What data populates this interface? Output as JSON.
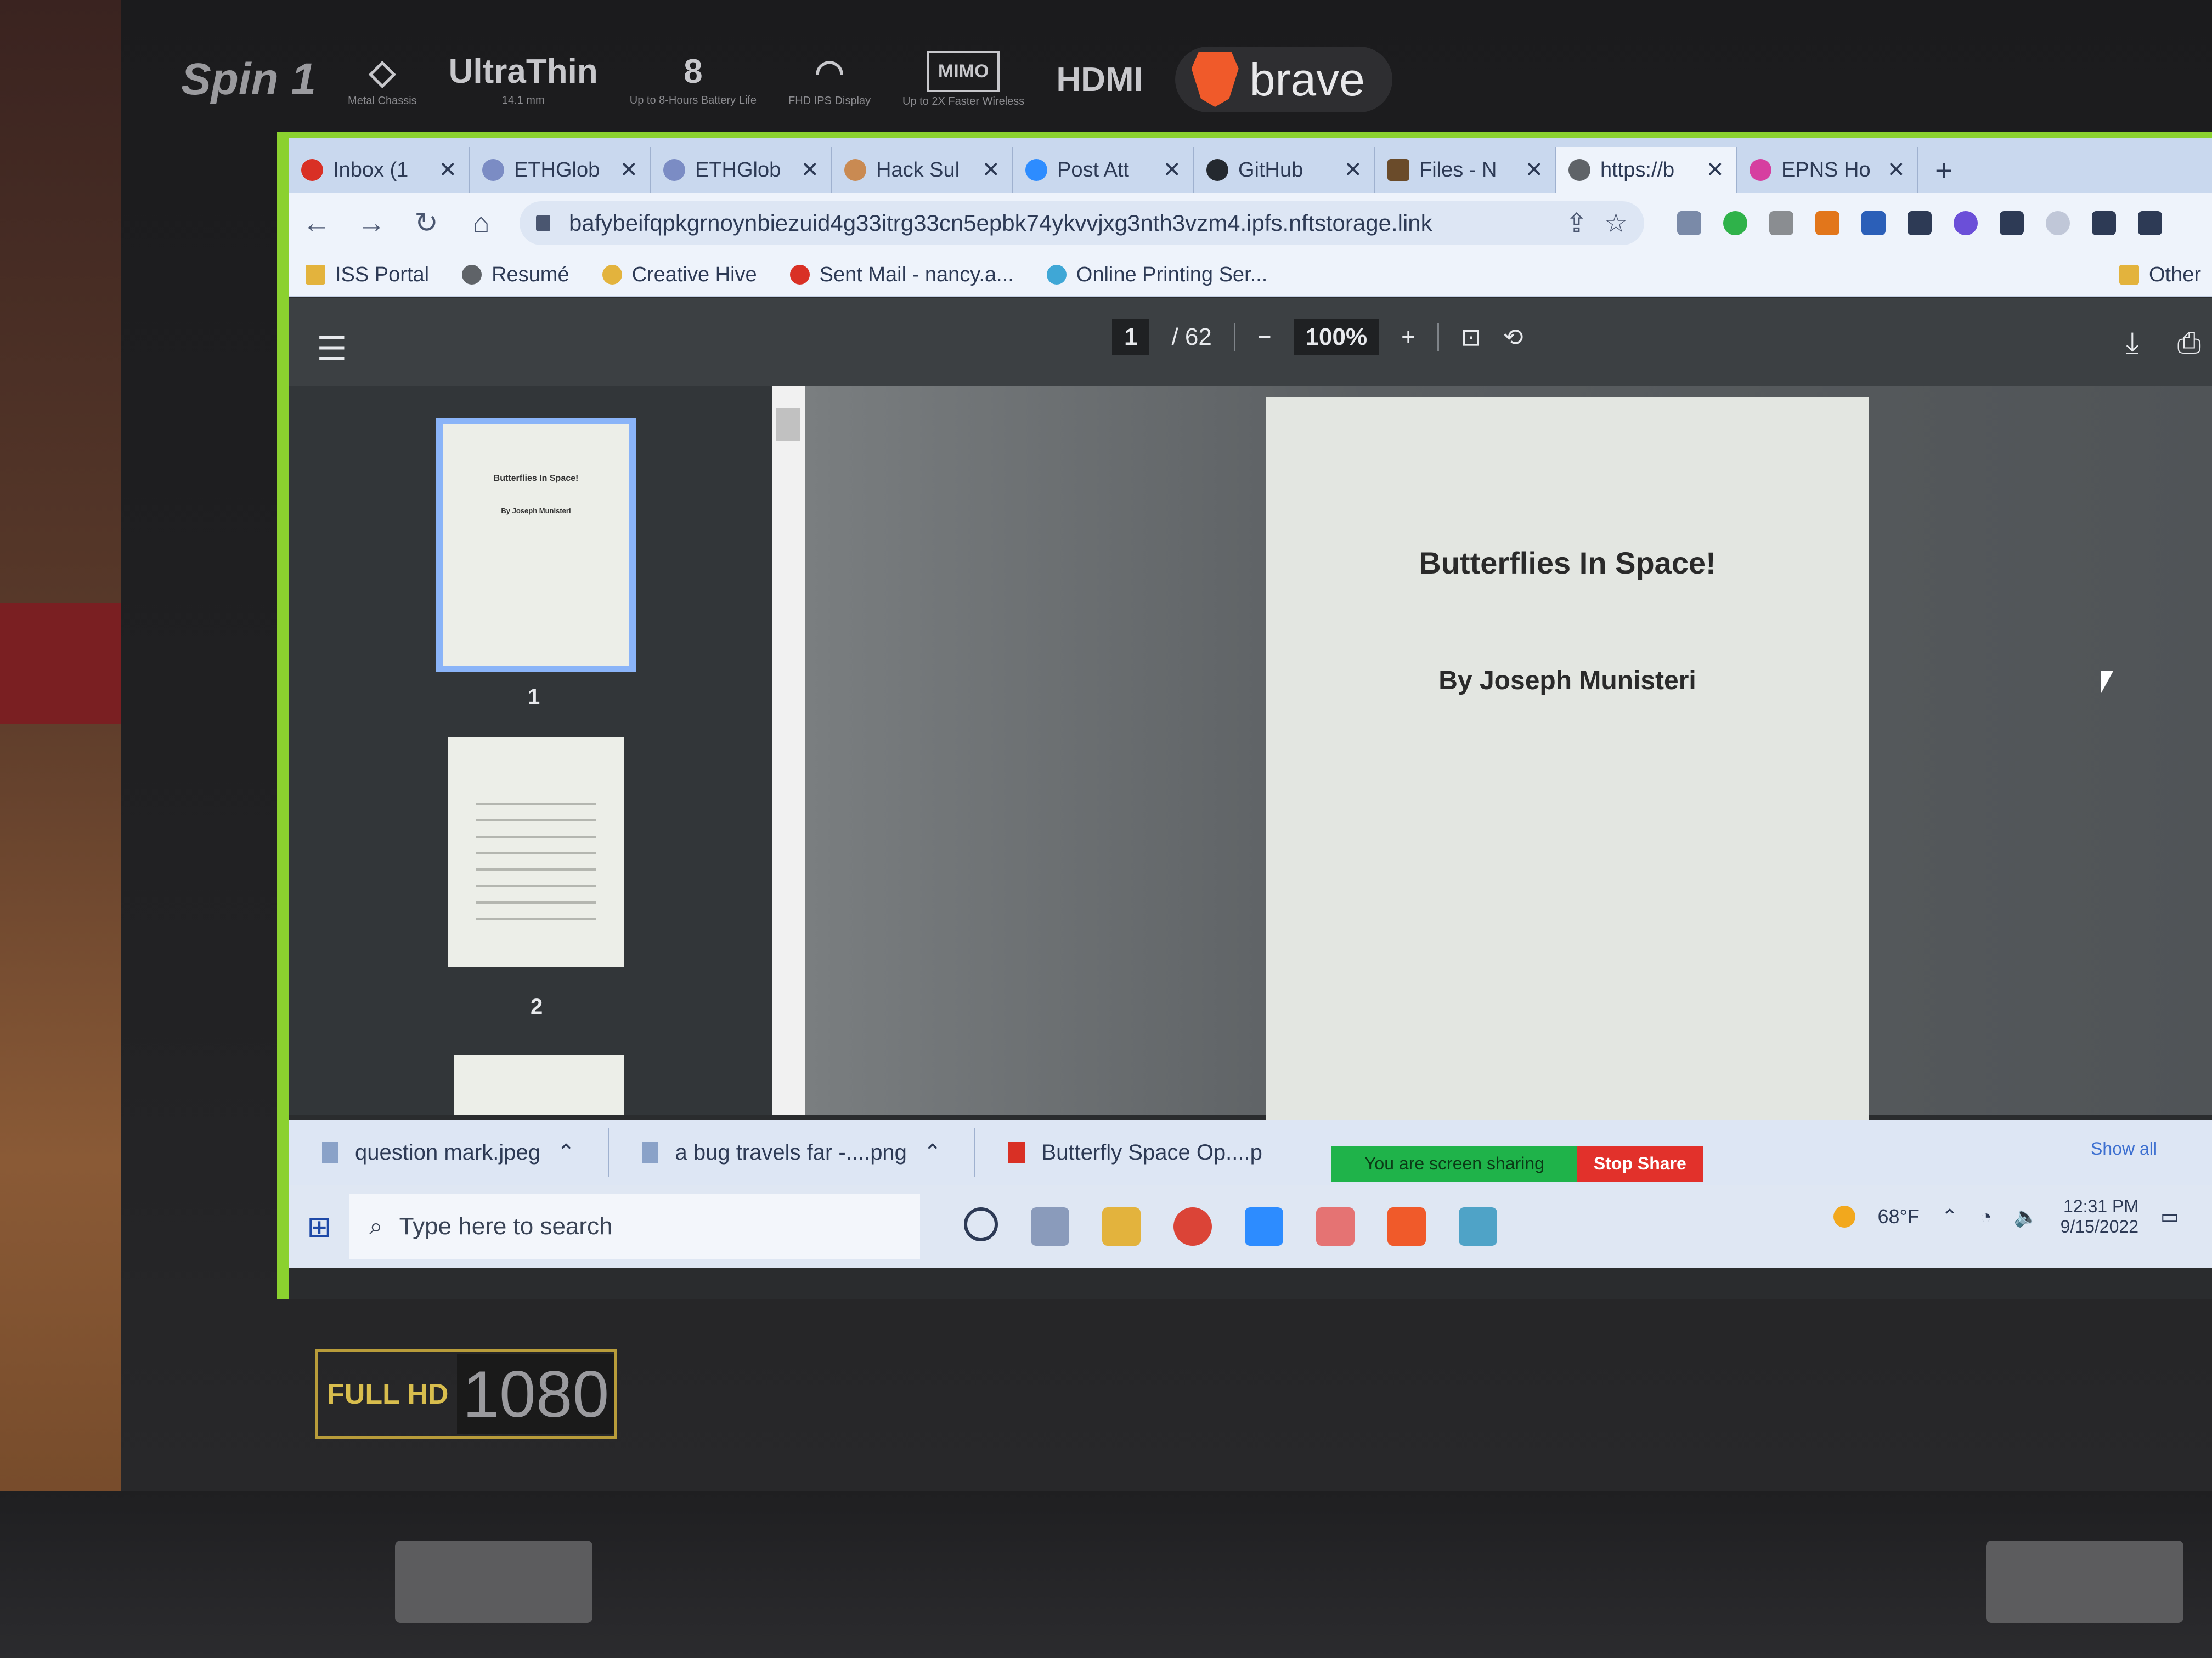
{
  "laptop": {
    "model": "Spin 1",
    "stickers": [
      {
        "big": "",
        "small": "Metal Chassis"
      },
      {
        "big": "UltraThin",
        "small": "14.1 mm"
      },
      {
        "big": "8",
        "small": "Up to 8-Hours Battery Life"
      },
      {
        "big": "",
        "small": "FHD IPS Display"
      },
      {
        "big": "MIMO",
        "small": "Up to 2X Faster Wireless"
      },
      {
        "big": "HDMI",
        "small": ""
      }
    ],
    "brave_badge": "brave",
    "fullhd_label": "FULL HD",
    "fullhd_number": "1080"
  },
  "browser": {
    "tabs": [
      {
        "label": "Inbox (1",
        "color": "#d93025"
      },
      {
        "label": "ETHGlob",
        "color": "#7b8cc4"
      },
      {
        "label": "ETHGlob",
        "color": "#7b8cc4"
      },
      {
        "label": "Hack Sul",
        "color": "#c98a52"
      },
      {
        "label": "Post Att",
        "color": "#2d8cff"
      },
      {
        "label": "GitHub",
        "color": "#24292f"
      },
      {
        "label": "Files - N",
        "color": "#6a4b2a"
      },
      {
        "label": "https://b",
        "color": "#5f6368"
      },
      {
        "label": "EPNS Ho",
        "color": "#d63fa0"
      }
    ],
    "active_tab_index": 7,
    "new_tab": "+",
    "url": "bafybeifqpkgrnoynbiezuid4g33itrg33cn5epbk74ykvvjxg3nth3vzm4.ipfs.nftstorage.link",
    "bookmarks": [
      {
        "label": "ISS Portal",
        "color": "#e3b33d"
      },
      {
        "label": "Resumé",
        "color": "#5f6368"
      },
      {
        "label": "Creative Hive",
        "color": "#e3b33d"
      },
      {
        "label": "Sent Mail - nancy.a...",
        "color": "#d93025"
      },
      {
        "label": "Online Printing Ser...",
        "color": "#3fa7d6"
      }
    ],
    "other_bookmarks": "Other"
  },
  "pdf": {
    "current_page": "1",
    "total_pages": "/ 62",
    "zoom": "100%",
    "thumbnails": [
      {
        "number": "1",
        "title": "Butterflies In Space!",
        "author": "By Joseph Munisteri"
      },
      {
        "number": "2"
      }
    ],
    "page_title": "Butterflies In Space!",
    "page_author": "By Joseph Munisteri"
  },
  "downloads": [
    {
      "name": "question mark.jpeg"
    },
    {
      "name": "a bug travels far -....png"
    },
    {
      "name": "Butterfly Space Op....p"
    }
  ],
  "show_all": "Show all",
  "screen_share": {
    "status": "You are screen sharing",
    "stop": "Stop Share"
  },
  "taskbar": {
    "search_placeholder": "Type here to search",
    "weather": "68°F",
    "time": "12:31 PM",
    "date": "9/15/2022"
  }
}
